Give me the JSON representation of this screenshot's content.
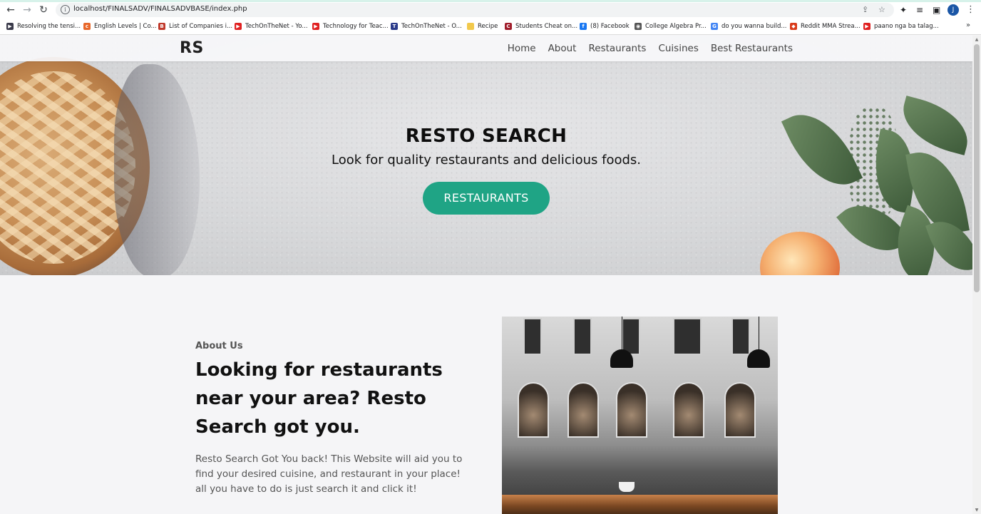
{
  "browser": {
    "url": "localhost/FINALSADV/FINALSADVBASE/index.php",
    "profile_initial": "J",
    "bookmarks": [
      {
        "label": "Resolving the tensi...",
        "color": "#3a3a4a",
        "glyph": "▶"
      },
      {
        "label": "English Levels | Co...",
        "color": "#e8672a",
        "glyph": "c"
      },
      {
        "label": "List of Companies i...",
        "color": "#c0392b",
        "glyph": "B"
      },
      {
        "label": "TechOnTheNet - Yo...",
        "color": "#e02020",
        "glyph": "▶"
      },
      {
        "label": "Technology for Teac...",
        "color": "#e02020",
        "glyph": "▶"
      },
      {
        "label": "TechOnTheNet - O...",
        "color": "#2a3a8a",
        "glyph": "T"
      },
      {
        "label": "Recipe",
        "color": "#f2c94c",
        "glyph": ""
      },
      {
        "label": "Students Cheat on...",
        "color": "#a01d2b",
        "glyph": "C"
      },
      {
        "label": "(8) Facebook",
        "color": "#1877f2",
        "glyph": "f"
      },
      {
        "label": "College Algebra Pr...",
        "color": "#555555",
        "glyph": "◉"
      },
      {
        "label": "do you wanna build...",
        "color": "#4285f4",
        "glyph": "G"
      },
      {
        "label": "Reddit MMA Strea...",
        "color": "#d93a1a",
        "glyph": "◆"
      },
      {
        "label": "paano nga ba talag...",
        "color": "#e02020",
        "glyph": "▶"
      }
    ]
  },
  "site": {
    "logo": "RS",
    "nav": [
      "Home",
      "About",
      "Restaurants",
      "Cuisines",
      "Best Restaurants"
    ]
  },
  "hero": {
    "title": "RESTO SEARCH",
    "subtitle": "Look for quality restaurants and delicious foods.",
    "button": "RESTAURANTS"
  },
  "about": {
    "label": "About Us",
    "heading": "Looking for restaurants near your area? Resto Search got you.",
    "text": "Resto Search Got You back! This Website will aid you to find your desired cuisine, and restaurant in your place! all you have to do is just search it and click it!"
  },
  "colors": {
    "accent": "#1fa485"
  }
}
